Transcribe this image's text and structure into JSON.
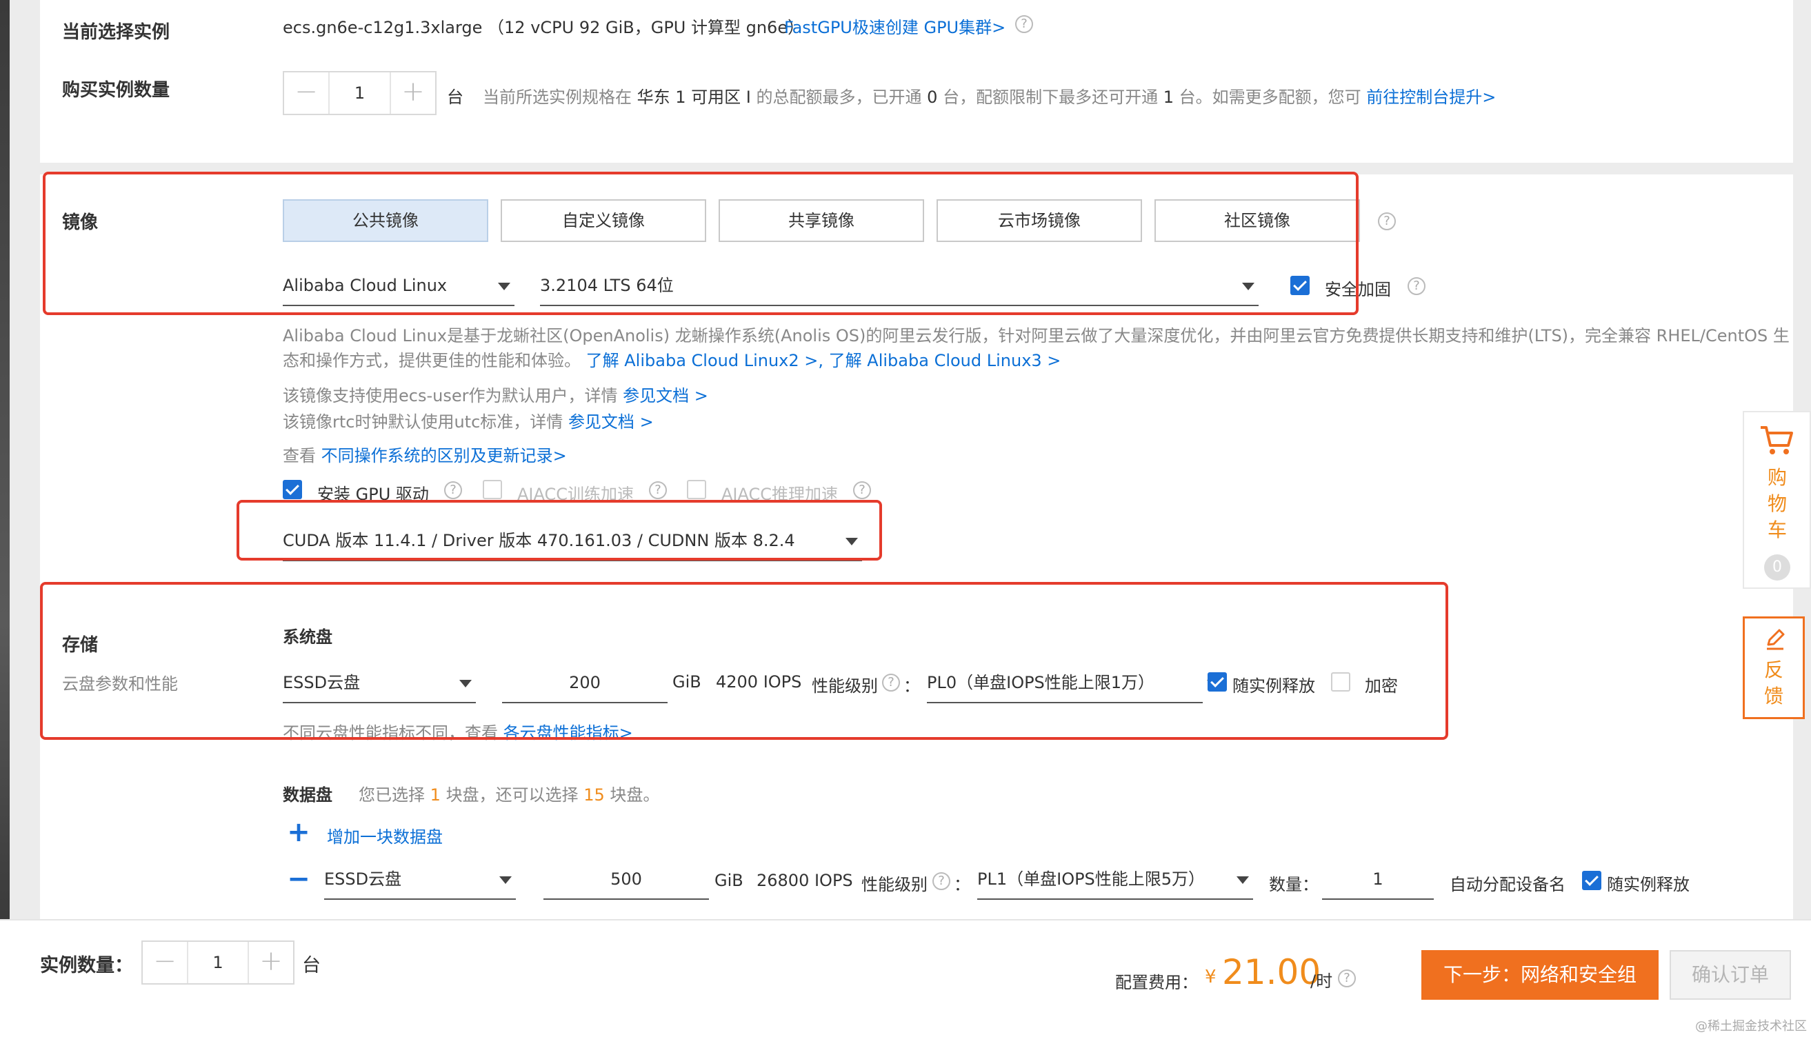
{
  "instance": {
    "label": "当前选择实例",
    "spec": "ecs.gn6e-c12g1.3xlarge （12 vCPU 92 GiB，GPU 计算型 gn6e）",
    "fastgpu_link": "FastGPU极速创建 GPU集群>",
    "quantity_label": "购买实例数量",
    "quantity_value": "1",
    "unit": "台",
    "quota_text_a": "当前所选实例规格在",
    "quota_region": "华东 1 可用区 I",
    "quota_text_b": "的总配额最多，已开通",
    "quota_opened": "0",
    "quota_text_c": "台，配额限制下最多还可开通",
    "quota_more": "1",
    "quota_text_d": "台。如需更多配额，您可",
    "quota_link": "前往控制台提升>"
  },
  "image": {
    "label": "镜像",
    "tabs": [
      "公共镜像",
      "自定义镜像",
      "共享镜像",
      "云市场镜像",
      "社区镜像"
    ],
    "os_select": "Alibaba Cloud Linux",
    "version_select": "3.2104 LTS 64位",
    "security_hardening": "安全加固",
    "desc_line1": "Alibaba Cloud Linux是基于龙蜥社区(OpenAnolis) 龙蜥操作系统(Anolis OS)的阿里云发行版，针对阿里云做了大量深度优化，并由阿里云官方免费提供长期支持和维护(LTS)，完全兼容 RHEL/CentOS 生",
    "desc_line2": "态和操作方式，提供更佳的性能和体验。",
    "desc_link1": "了解 Alibaba Cloud Linux2 >,",
    "desc_link2": "了解 Alibaba Cloud Linux3 >",
    "ecs_user_text": "该镜像支持使用ecs-user作为默认用户，详情",
    "ecs_user_link": "参见文档 >",
    "rtc_text": "该镜像rtc时钟默认使用utc标准，详情",
    "rtc_link": "参见文档 >",
    "compare_text": "查看",
    "compare_link": "不同操作系统的区别及更新记录>",
    "gpu_driver": "安装 GPU 驱动",
    "aiacc_train": "AIACC训练加速",
    "aiacc_infer": "AIACC推理加速",
    "cuda_select": "CUDA 版本 11.4.1 / Driver 版本 470.161.03 / CUDNN 版本 8.2.4"
  },
  "storage": {
    "label": "存储",
    "sublabel": "云盘参数和性能",
    "system_disk_title": "系统盘",
    "system_disk": {
      "type": "ESSD云盘",
      "size": "200",
      "unit": "GiB",
      "iops": "4200 IOPS",
      "perf_label": "性能级别",
      "colon": "：",
      "perf_value": "PL0（单盘IOPS性能上限1万）",
      "release": "随实例释放",
      "encrypt": "加密"
    },
    "perf_note": "不同云盘性能指标不同，查看",
    "perf_note_link": "各云盘性能指标>",
    "data_disk_title": "数据盘",
    "data_disk_note_a": "您已选择",
    "data_disk_selected": "1",
    "data_disk_note_b": "块盘，还可以选择",
    "data_disk_remaining": "15",
    "data_disk_note_c": "块盘。",
    "add_data_disk": "增加一块数据盘",
    "data_disk": {
      "type": "ESSD云盘",
      "size": "500",
      "unit": "GiB",
      "iops": "26800 IOPS",
      "perf_label": "性能级别",
      "colon": "：",
      "perf_value": "PL1（单盘IOPS性能上限5万）",
      "qty_label": "数量：",
      "qty_value": "1",
      "auto_device": "自动分配设备名",
      "release": "随实例释放"
    }
  },
  "cart": {
    "chars": [
      "购",
      "物",
      "车"
    ],
    "count": "0"
  },
  "feedback": {
    "chars": [
      "反",
      "馈"
    ]
  },
  "footer": {
    "qty_label": "实例数量：",
    "qty_value": "1",
    "unit": "台",
    "cost_label": "配置费用：",
    "currency": "¥",
    "price": "21.00",
    "per": "/时",
    "next_button": "下一步：网络和安全组",
    "confirm_button": "确认订单"
  },
  "watermark": "@稀土掘金技术社区",
  "colors": {
    "accent": "#0b6fd6",
    "primary_button": "#f0701f",
    "highlight": "#e53b2c"
  }
}
